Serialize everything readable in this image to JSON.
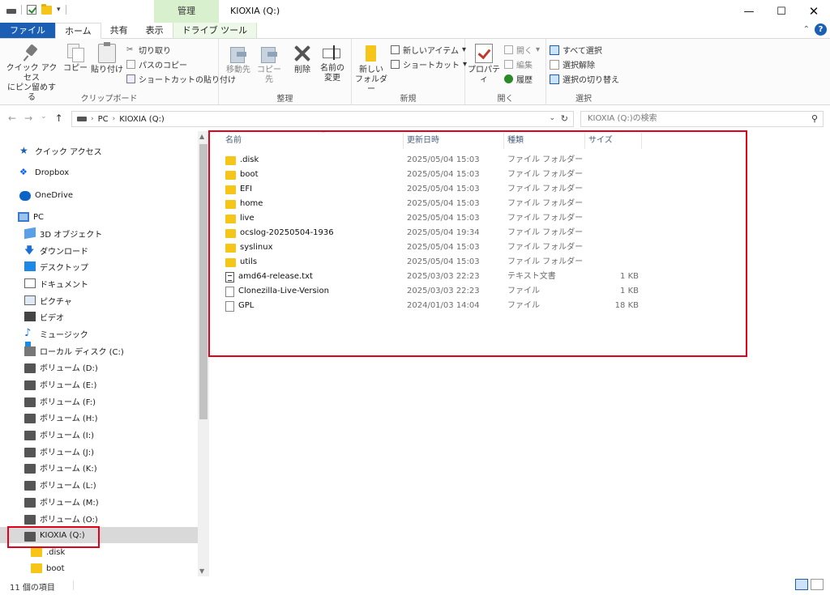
{
  "window": {
    "title": "KIOXIA (Q:)",
    "manage_tab": "管理",
    "minimize": "—",
    "maximize": "☐",
    "close": "✕"
  },
  "tabs": [
    {
      "label": "ファイル"
    },
    {
      "label": "ホーム"
    },
    {
      "label": "共有"
    },
    {
      "label": "表示"
    },
    {
      "label": "ドライブ ツール"
    }
  ],
  "ribbon": {
    "clipboard": {
      "pin": "クイック アクセス",
      "pin2": "にピン留めする",
      "copy": "コピー",
      "paste": "貼り付け",
      "cut": "切り取り",
      "copy_path": "パスのコピー",
      "paste_shortcut": "ショートカットの貼り付け",
      "label": "クリップボード"
    },
    "organize": {
      "move_to": "移動先",
      "copy_to": "コピー先",
      "delete": "削除",
      "rename": "名前の",
      "rename2": "変更",
      "label": "整理"
    },
    "new": {
      "new_item": "新しいアイテム",
      "shortcut": "ショートカット",
      "new_folder": "新しい",
      "new_folder2": "フォルダー",
      "label": "新規"
    },
    "open": {
      "properties": "プロパティ",
      "open": "開く",
      "edit": "編集",
      "history": "履歴",
      "label": "開く"
    },
    "select": {
      "select_all": "すべて選択",
      "select_none": "選択解除",
      "invert": "選択の切り替え",
      "label": "選択"
    }
  },
  "address": {
    "pc": "PC",
    "drive": "KIOXIA (Q:)",
    "search_placeholder": "KIOXIA (Q:)の検索"
  },
  "nav": {
    "items": [
      {
        "label": "クイック アクセス",
        "icon": "star-icon"
      },
      {
        "label": "Dropbox",
        "icon": "dropbox-icon"
      },
      {
        "label": "OneDrive",
        "icon": "cloud-icon"
      },
      {
        "label": "PC",
        "icon": "pc-icon"
      },
      {
        "label": "3D オブジェクト",
        "icon": "cube-icon"
      },
      {
        "label": "ダウンロード",
        "icon": "download-icon"
      },
      {
        "label": "デスクトップ",
        "icon": "desktop-icon"
      },
      {
        "label": "ドキュメント",
        "icon": "document-icon"
      },
      {
        "label": "ピクチャ",
        "icon": "picture-icon"
      },
      {
        "label": "ビデオ",
        "icon": "video-icon"
      },
      {
        "label": "ミュージック",
        "icon": "music-icon"
      },
      {
        "label": "ローカル ディスク (C:)",
        "icon": "windows-drive-icon"
      },
      {
        "label": "ボリューム (D:)",
        "icon": "drive-icon"
      },
      {
        "label": "ボリューム (E:)",
        "icon": "drive-icon"
      },
      {
        "label": "ボリューム (F:)",
        "icon": "drive-icon"
      },
      {
        "label": "ボリューム (H:)",
        "icon": "drive-icon"
      },
      {
        "label": "ボリューム (I:)",
        "icon": "drive-icon"
      },
      {
        "label": "ボリューム (J:)",
        "icon": "drive-icon"
      },
      {
        "label": "ボリューム (K:)",
        "icon": "drive-icon"
      },
      {
        "label": "ボリューム (L:)",
        "icon": "drive-icon"
      },
      {
        "label": "ボリューム (M:)",
        "icon": "drive-icon"
      },
      {
        "label": "ボリューム (O:)",
        "icon": "drive-icon"
      },
      {
        "label": "KIOXIA (Q:)",
        "icon": "drive-icon"
      },
      {
        "label": ".disk",
        "icon": "folder-icon"
      },
      {
        "label": "boot",
        "icon": "folder-icon"
      }
    ]
  },
  "list": {
    "columns": {
      "name": "名前",
      "date": "更新日時",
      "type": "種類",
      "size": "サイズ"
    },
    "rows": [
      {
        "name": ".disk",
        "date": "2025/05/04 15:03",
        "type": "ファイル フォルダー",
        "size": "",
        "icon": "folder-icon"
      },
      {
        "name": "boot",
        "date": "2025/05/04 15:03",
        "type": "ファイル フォルダー",
        "size": "",
        "icon": "folder-icon"
      },
      {
        "name": "EFI",
        "date": "2025/05/04 15:03",
        "type": "ファイル フォルダー",
        "size": "",
        "icon": "folder-icon"
      },
      {
        "name": "home",
        "date": "2025/05/04 15:03",
        "type": "ファイル フォルダー",
        "size": "",
        "icon": "folder-icon"
      },
      {
        "name": "live",
        "date": "2025/05/04 15:03",
        "type": "ファイル フォルダー",
        "size": "",
        "icon": "folder-icon"
      },
      {
        "name": "ocslog-20250504-1936",
        "date": "2025/05/04 19:34",
        "type": "ファイル フォルダー",
        "size": "",
        "icon": "folder-icon"
      },
      {
        "name": "syslinux",
        "date": "2025/05/04 15:03",
        "type": "ファイル フォルダー",
        "size": "",
        "icon": "folder-icon"
      },
      {
        "name": "utils",
        "date": "2025/05/04 15:03",
        "type": "ファイル フォルダー",
        "size": "",
        "icon": "folder-icon"
      },
      {
        "name": "amd64-release.txt",
        "date": "2025/03/03 22:23",
        "type": "テキスト文書",
        "size": "1 KB",
        "icon": "text-file-icon"
      },
      {
        "name": "Clonezilla-Live-Version",
        "date": "2025/03/03 22:23",
        "type": "ファイル",
        "size": "1 KB",
        "icon": "file-icon"
      },
      {
        "name": "GPL",
        "date": "2024/01/03 14:04",
        "type": "ファイル",
        "size": "18 KB",
        "icon": "file-icon"
      }
    ]
  },
  "status": {
    "count": "11 個の項目"
  },
  "colors": {
    "accent": "#1a5fb4",
    "highlight": "#e2001a",
    "manage_tab": "#d9f0cf"
  }
}
